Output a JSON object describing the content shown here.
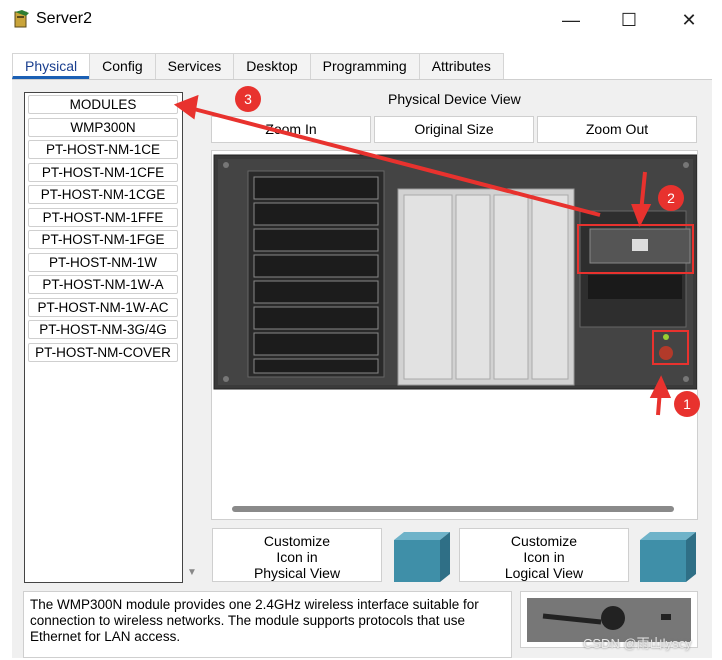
{
  "window": {
    "title": "Server2",
    "minimize": "—",
    "maximize": "☐",
    "close": "✕"
  },
  "tabs": [
    {
      "label": "Physical",
      "active": true
    },
    {
      "label": "Config"
    },
    {
      "label": "Services"
    },
    {
      "label": "Desktop"
    },
    {
      "label": "Programming"
    },
    {
      "label": "Attributes"
    }
  ],
  "modules": [
    "MODULES",
    "WMP300N",
    "PT-HOST-NM-1CE",
    "PT-HOST-NM-1CFE",
    "PT-HOST-NM-1CGE",
    "PT-HOST-NM-1FFE",
    "PT-HOST-NM-1FGE",
    "PT-HOST-NM-1W",
    "PT-HOST-NM-1W-A",
    "PT-HOST-NM-1W-AC",
    "PT-HOST-NM-3G/4G",
    "PT-HOST-NM-COVER"
  ],
  "device_view": {
    "title": "Physical Device View",
    "zoom_in": "Zoom In",
    "original_size": "Original Size",
    "zoom_out": "Zoom Out"
  },
  "customize": {
    "physical": [
      "Customize",
      "Icon in",
      "Physical View"
    ],
    "logical": [
      "Customize",
      "Icon in",
      "Logical View"
    ]
  },
  "description": "The WMP300N module provides one 2.4GHz wireless interface suitable for connection to wireless networks. The module supports protocols that use Ethernet for LAN access.",
  "annotations": [
    "1",
    "2",
    "3"
  ],
  "watermark": "CSDN @雨山lyscy",
  "colors": {
    "accent": "#1a5fb4",
    "annotation": "#e8322e",
    "cube": "#3f8fa8"
  }
}
